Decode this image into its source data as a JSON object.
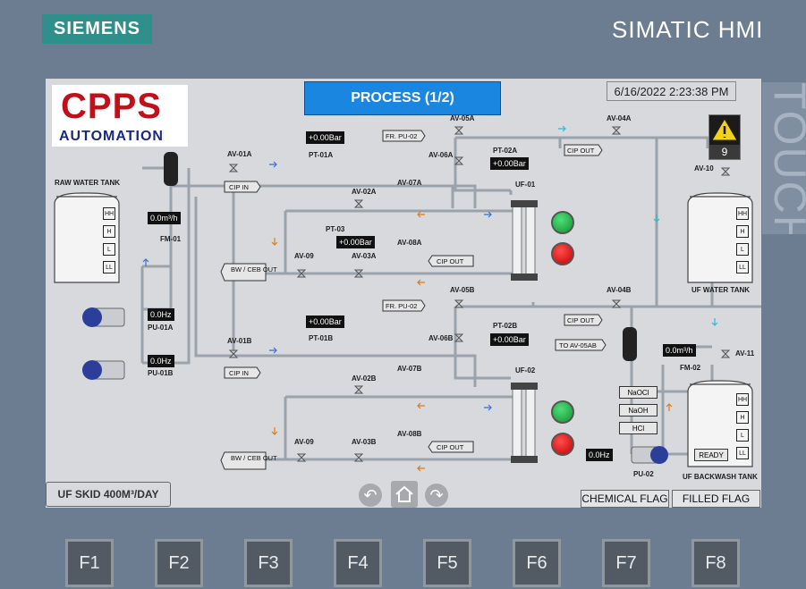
{
  "frame": {
    "brand": "SIEMENS",
    "model": "SIMATIC HMI",
    "side_label": "TOUCH"
  },
  "fkeys": [
    "F1",
    "F2",
    "F3",
    "F4",
    "F5",
    "F6",
    "F7",
    "F8"
  ],
  "logo": {
    "big": "CPPS",
    "small": "AUTOMATION"
  },
  "header": {
    "title": "PROCESS (1/2)",
    "datetime": "6/16/2022 2:23:38 PM"
  },
  "alarm": {
    "count": "9"
  },
  "tanks": {
    "raw": "RAW WATER TANK",
    "uf": "UF WATER TANK",
    "backwash": "UF BACKWASH TANK",
    "levels": [
      "HH",
      "H",
      "L",
      "LL"
    ]
  },
  "valves": {
    "av01a": "AV-01A",
    "av02a": "AV-02A",
    "av07a": "AV-07A",
    "av08a": "AV-08A",
    "av03a": "AV-03A",
    "av09a": "AV-09",
    "av05a": "AV-05A",
    "av06a": "AV-06A",
    "av04a": "AV-04A",
    "av10": "AV-10",
    "av01b": "AV-01B",
    "av02b": "AV-02B",
    "av07b": "AV-07B",
    "av08b": "AV-08B",
    "av03b": "AV-03B",
    "av09b": "AV-09",
    "av05b": "AV-05B",
    "av06b": "AV-06B",
    "av04b": "AV-04B",
    "av11": "AV-11"
  },
  "instruments": {
    "pt01a": "PT-01A",
    "pt01a_val": "+0.00Bar",
    "pt02a": "PT-02A",
    "pt02a_val": "+0.00Bar",
    "pt03": "PT-03",
    "pt03_val": "+0.00Bar",
    "pt01b": "PT-01B",
    "pt01b_val": "+0.00Bar",
    "pt02b": "PT-02B",
    "pt02b_val": "+0.00Bar",
    "fm01": "FM-01",
    "fm01_val": "0.0m³/h",
    "fm02": "FM-02",
    "fm02_val": "0.0m³/h"
  },
  "pumps": {
    "pu01a": "PU-01A",
    "pu01a_val": "0.0Hz",
    "pu01b": "PU-01B",
    "pu01b_val": "0.0Hz",
    "pu02": "PU-02",
    "pu02_val": "0.0Hz"
  },
  "units": {
    "uf01": "UF-01",
    "uf02": "UF-02"
  },
  "tags": {
    "cip_in": "CIP IN",
    "bw_ceb_out": "BW / CEB OUT",
    "fr_pu02": "FR. PU-02",
    "cip_out": "CIP OUT",
    "to_av05ab": "TO AV-05AB"
  },
  "chemicals": [
    "NaOCl",
    "NaOH",
    "HCl"
  ],
  "ready": "READY",
  "footer": {
    "skid": "UF SKID 400M³/DAY",
    "chemical_flag": "CHEMICAL FLAG",
    "filled_flag": "FILLED FLAG"
  }
}
